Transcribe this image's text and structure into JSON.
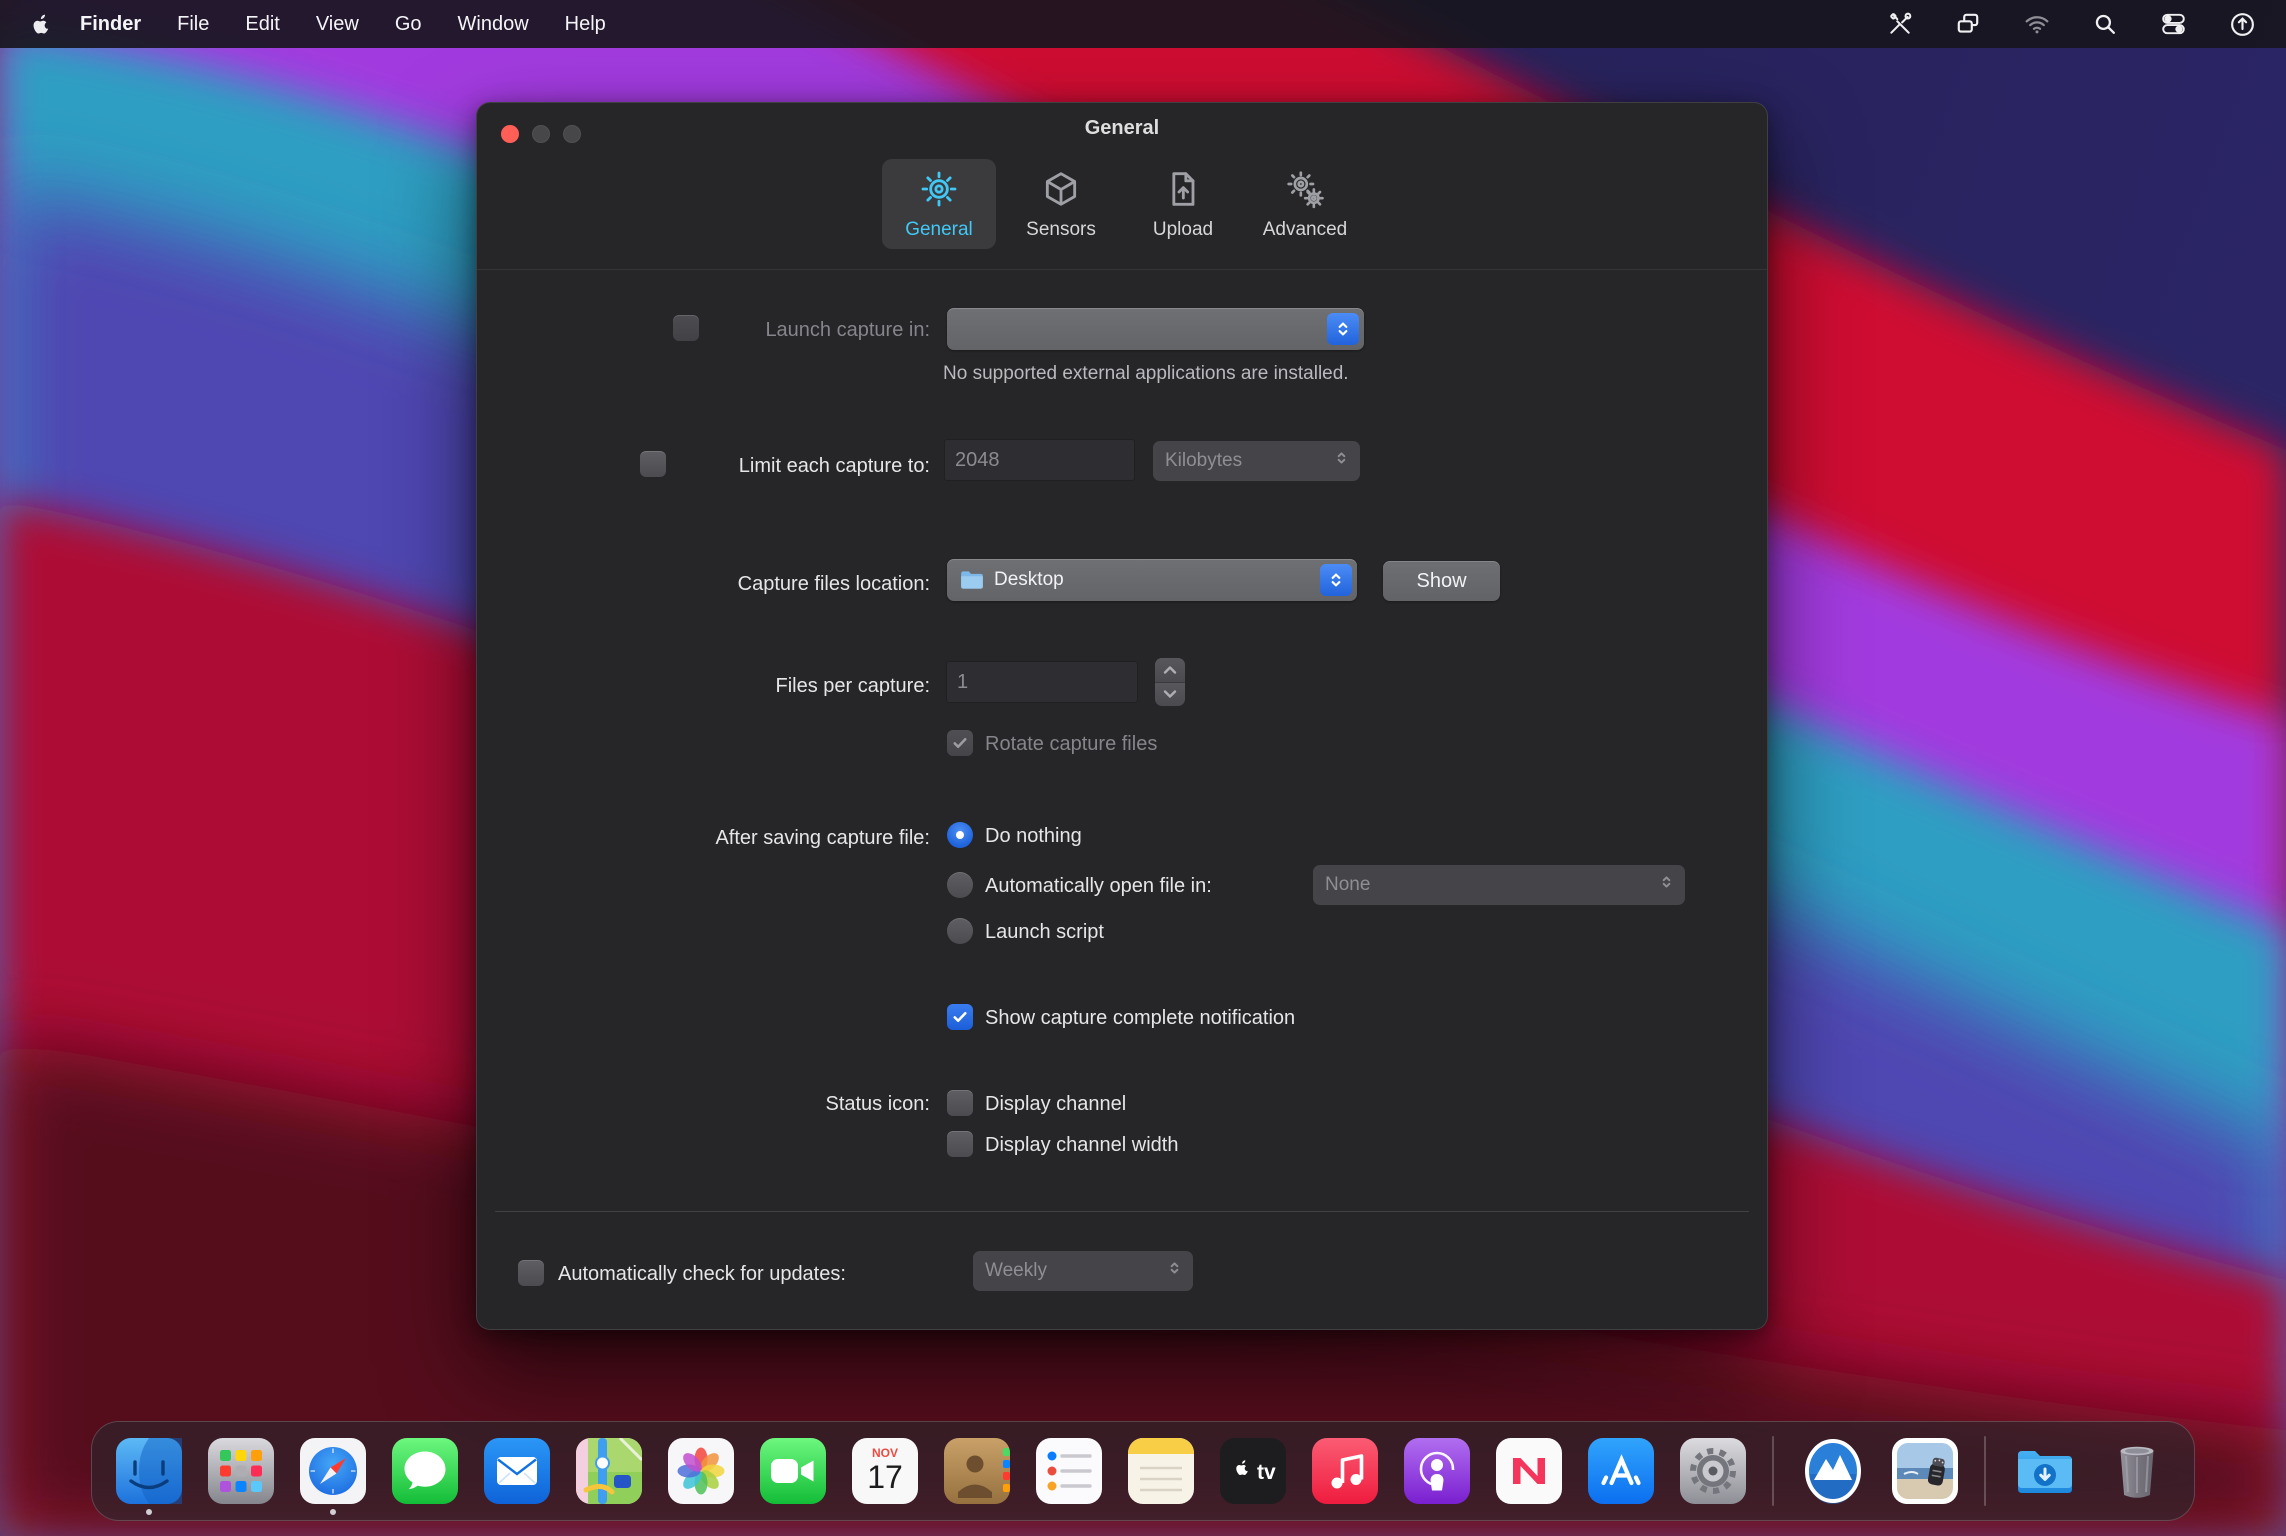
{
  "menu_bar": {
    "app_name": "Finder",
    "menus": [
      "File",
      "Edit",
      "View",
      "Go",
      "Window",
      "Help"
    ]
  },
  "window": {
    "title": "General",
    "tabs": [
      {
        "label": "General"
      },
      {
        "label": "Sensors"
      },
      {
        "label": "Upload"
      },
      {
        "label": "Advanced"
      }
    ],
    "form": {
      "launch_capture": {
        "label": "Launch capture in:",
        "value": "",
        "note": "No supported external applications are installed."
      },
      "limit_capture": {
        "label": "Limit each capture to:",
        "value": "2048",
        "unit": "Kilobytes"
      },
      "location": {
        "label": "Capture files location:",
        "value": "Desktop",
        "button": "Show"
      },
      "files_per_capture": {
        "label": "Files per capture:",
        "value": "1",
        "rotate_label": "Rotate capture files"
      },
      "after_saving": {
        "label": "After saving capture file:",
        "option_do_nothing": "Do nothing",
        "option_auto_open": "Automatically open file in:",
        "auto_open_value": "None",
        "option_launch_script": "Launch script"
      },
      "notification_label": "Show capture complete notification",
      "status_icon": {
        "label": "Status icon:",
        "option_channel": "Display channel",
        "option_channel_width": "Display channel width"
      },
      "updates": {
        "label": "Automatically check for updates:",
        "value": "Weekly"
      }
    }
  },
  "dock": {
    "calendar": {
      "month": "NOV",
      "day": "17"
    },
    "tv_label": "tv"
  },
  "colors": {
    "accent_blue": "#2265dd",
    "tab_active_cyan": "#41c8f4",
    "traffic_red": "#ff5f57"
  }
}
